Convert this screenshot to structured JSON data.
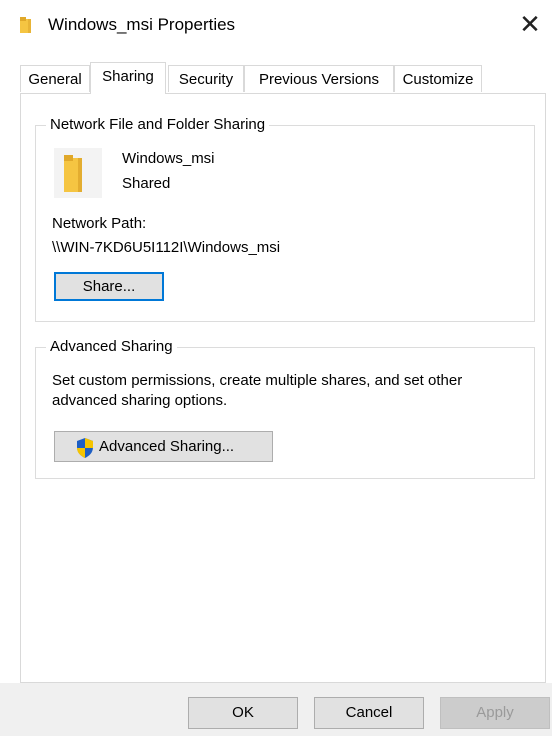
{
  "window": {
    "title": "Windows_msi Properties",
    "close_glyph": "✕"
  },
  "tabs": [
    {
      "label": "General",
      "active": false
    },
    {
      "label": "Sharing",
      "active": true
    },
    {
      "label": "Security",
      "active": false
    },
    {
      "label": "Previous Versions",
      "active": false
    },
    {
      "label": "Customize",
      "active": false
    }
  ],
  "network_sharing": {
    "group_label": "Network File and Folder Sharing",
    "folder_name": "Windows_msi",
    "status": "Shared",
    "path_label": "Network Path:",
    "path_value": "\\\\WIN-7KD6U5I112I\\Windows_msi",
    "share_button": "Share..."
  },
  "advanced_sharing": {
    "group_label": "Advanced Sharing",
    "description_line1": "Set custom permissions, create multiple shares, and set other",
    "description_line2": "advanced sharing options.",
    "button_label": "Advanced Sharing..."
  },
  "footer": {
    "ok": "OK",
    "cancel": "Cancel",
    "apply": "Apply"
  },
  "colors": {
    "folder": "#f5c542",
    "accent": "#0078d7",
    "shield_blue": "#1e5fc4",
    "shield_yellow": "#f5c400"
  }
}
